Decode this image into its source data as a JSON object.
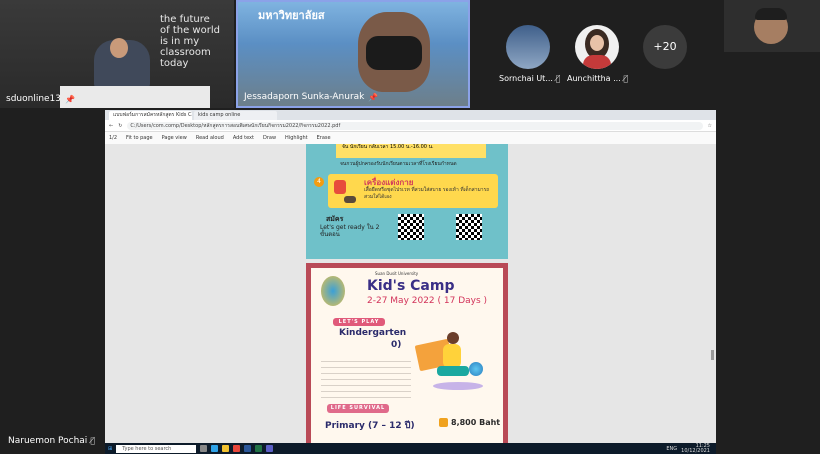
{
  "meeting": {
    "participants": [
      {
        "name": "sduonline13",
        "background_text": [
          "the future",
          "of the world",
          "is in my",
          "classroom",
          "today"
        ]
      },
      {
        "name": "Jessadaporn Sunka-Anurak",
        "background_text": "มหาวิทยาลัยส"
      },
      {
        "name": "Sornchai Ut...",
        "muted": true
      },
      {
        "name": "Aunchittha ...",
        "muted": true
      },
      {
        "count": "+20"
      }
    ],
    "self": {
      "name": "Naruemon Pochai"
    }
  },
  "browser": {
    "tabs": [
      {
        "label": "แบบฟอร์มการสมัครหลักสูตร Kids Camp 2022 สาธิตสวนดุสิต..."
      },
      {
        "label": "kids camp online"
      }
    ],
    "address": "C:/Users/com.comp/Desktop/หลักสูตรการสอนพิเศษนักเรียนกิจกรรม2022/กิจกรรม2022.pdf",
    "pdf_toolbar": [
      "1/2",
      "Fit to page",
      "Page view",
      "Read aloud",
      "Add text",
      "Draw",
      "Highlight",
      "Erase"
    ]
  },
  "poster1": {
    "line1": "จัน นักเรียน กลับเวลา 15.00 น.-16.00 น.",
    "line2": "จนกวนผู้ปกครองรับนักเรียนตามเวลาที่โรงเรียนกำหนด",
    "num": "4",
    "heading": "เครื่องแต่งกาย",
    "text": "เสื้อยืดหรือชุดไปรเวท ที่สวมใส่สบาย รองเท้า ที่เด็กสามารถสวมใส่ได้เอง",
    "signup": "สมัคร",
    "cta": "Let's get ready ใน 2 ขั้นตอน"
  },
  "poster2": {
    "university": "Suan Dusit University",
    "title": "Kid's Camp",
    "dates": "2-27 May 2022 ( 17 Days )",
    "badge1": "LET'S PLAY",
    "program1": "Kindergarten",
    "program1_age": "0)",
    "badge2": "LIFE SURVIVAL",
    "program2": "Primary (7 – 12 ปี)",
    "price": "8,800 Baht"
  },
  "taskbar": {
    "search": "Type here to search",
    "time": "11:25",
    "date": "10/12/2021",
    "lang": "ENG"
  }
}
